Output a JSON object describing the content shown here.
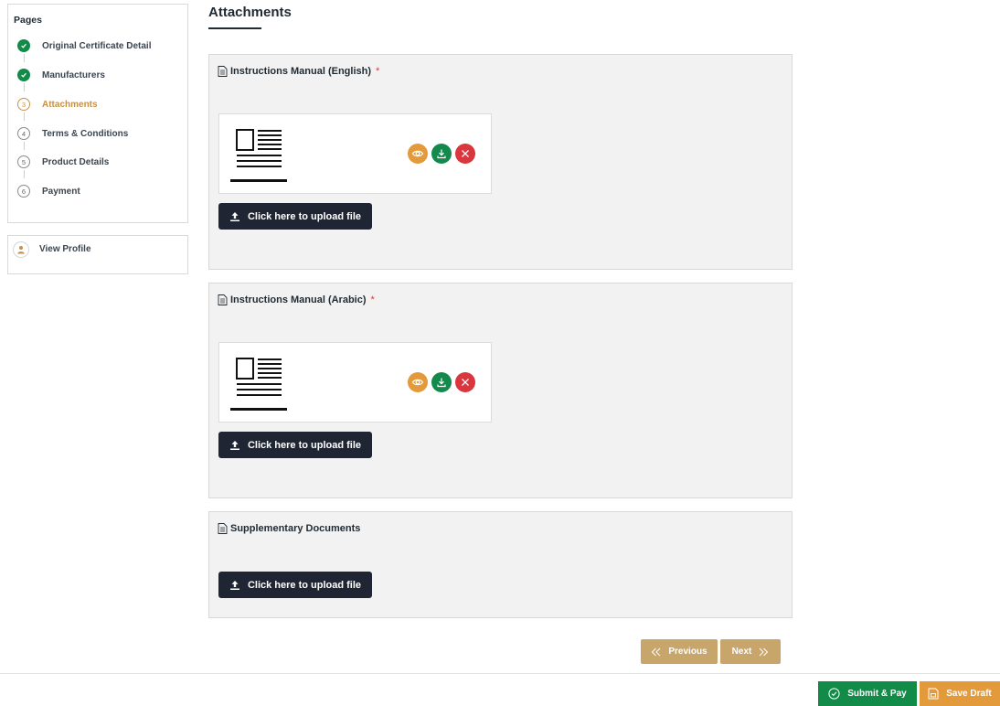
{
  "sidebar": {
    "title": "Pages",
    "steps": [
      {
        "label": "Original Certificate Detail",
        "status": "done",
        "num": "1"
      },
      {
        "label": "Manufacturers",
        "status": "done",
        "num": "2"
      },
      {
        "label": "Attachments",
        "status": "active",
        "num": "3"
      },
      {
        "label": "Terms & Conditions",
        "status": "todo",
        "num": "4"
      },
      {
        "label": "Product Details",
        "status": "todo",
        "num": "5"
      },
      {
        "label": "Payment",
        "status": "todo",
        "num": "6"
      }
    ],
    "profile_label": "View Profile"
  },
  "main": {
    "title": "Attachments",
    "cards": [
      {
        "title": "Instructions Manual (English)",
        "required_mark": "*",
        "upload_label": "Click here to upload file",
        "has_file": true
      },
      {
        "title": "Instructions Manual (Arabic)",
        "required_mark": "*",
        "upload_label": "Click here to upload file",
        "has_file": true
      },
      {
        "title": "Supplementary Documents",
        "upload_label": "Click here to upload file",
        "has_file": false
      }
    ]
  },
  "pager": {
    "previous_label": "Previous",
    "next_label": "Next"
  },
  "footer": {
    "submit_label": "Submit & Pay",
    "draft_label": "Save Draft"
  },
  "colors": {
    "done": "#128a48",
    "active": "#c4924a",
    "upload_button": "#1f2533",
    "pager": "#c8a56a",
    "view_action": "#e39a3b",
    "download_action": "#138a4c",
    "delete_action": "#d9363e"
  }
}
